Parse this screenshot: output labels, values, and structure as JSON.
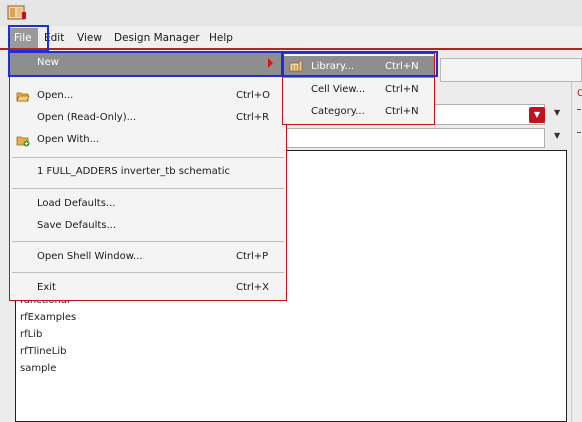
{
  "menubar": {
    "file": "File",
    "edit": "Edit",
    "view": "View",
    "design_manager": "Design Manager",
    "help": "Help"
  },
  "file_menu": {
    "new": "New",
    "open": "Open...",
    "open_shortcut": "Ctrl+O",
    "open_readonly": "Open (Read-Only)...",
    "open_readonly_shortcut": "Ctrl+R",
    "open_with": "Open With...",
    "recent_1": "1 FULL_ADDERS  inverter_tb  schematic",
    "load_defaults": "Load Defaults...",
    "save_defaults": "Save Defaults...",
    "open_shell": "Open Shell Window...",
    "open_shell_shortcut": "Ctrl+P",
    "exit": "Exit",
    "exit_shortcut": "Ctrl+X"
  },
  "new_submenu": {
    "library": "Library...",
    "library_shortcut": "Ctrl+N",
    "cell_view": "Cell View...",
    "cell_view_shortcut": "Ctrl+N",
    "category": "Category...",
    "category_shortcut": "Ctrl+N"
  },
  "library_list": [
    "functional",
    "rfExamples",
    "rfLib",
    "rfTlineLib",
    "sample"
  ],
  "colors": {
    "accent_red": "#c1121f",
    "highlight_blue": "#1f2fcf",
    "menu_selection": "#8e8e8e"
  }
}
